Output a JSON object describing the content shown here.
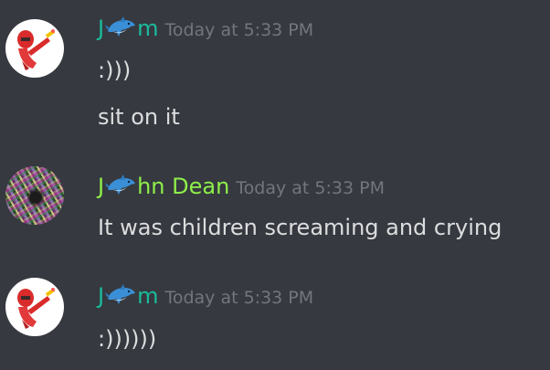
{
  "messages": [
    {
      "avatar": "white-avatar-with-red-figure",
      "name_prefix": "J",
      "name_suffix": "m",
      "timestamp": "Today at 5:33 PM",
      "lines": [
        ":)))",
        "sit on it"
      ],
      "name_color": "#1abc9c"
    },
    {
      "avatar": "glitch-art-avatar",
      "name_prefix": "J",
      "name_suffix": "hn Dean",
      "timestamp": "Today at 5:33 PM",
      "lines": [
        "It was children screaming and crying"
      ],
      "name_color": "#8ef04a"
    },
    {
      "avatar": "white-avatar-with-red-figure",
      "name_prefix": "J",
      "name_suffix": "m",
      "timestamp": "Today at 5:33 PM",
      "lines": [
        ":))))))"
      ],
      "name_color": "#1abc9c"
    }
  ],
  "icons": {
    "name_emoji": "dolphin-icon"
  },
  "colors": {
    "background": "#36393f",
    "text": "#dcddde",
    "timestamp": "#72767d"
  }
}
